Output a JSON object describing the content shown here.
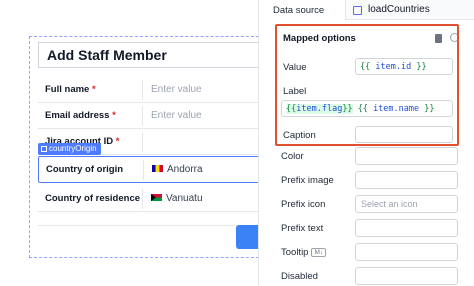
{
  "form": {
    "title": "Add Staff Member",
    "component_tag": "countryOrigin",
    "fields": [
      {
        "label": "Full name",
        "required": "*",
        "value": "Enter value",
        "is_placeholder": true
      },
      {
        "label": "Email address",
        "required": "*",
        "value": "Enter value",
        "is_placeholder": true
      },
      {
        "label": "Jira account ID",
        "required": "*",
        "value": "",
        "is_placeholder": true
      },
      {
        "label": "Country of origin",
        "required": "",
        "value": "Andorra",
        "is_placeholder": false
      },
      {
        "label": "Country of residence",
        "required": "",
        "value": "Vanuatu",
        "is_placeholder": false
      }
    ]
  },
  "panel": {
    "data_source_label": "Data source",
    "data_source_value": "loadCountries",
    "mapped_options": {
      "title": "Mapped options",
      "value_label": "Value",
      "value_code": {
        "open": "{{",
        "expr": "item.id",
        "close": "}}"
      },
      "label_label": "Label",
      "label_code": {
        "open1": "{{",
        "expr1": "item.flag",
        "close1": "}}",
        "open2": "{{",
        "expr2": "item.name",
        "close2": "}}"
      },
      "caption_label": "Caption",
      "caption_value": ""
    },
    "props": [
      {
        "label": "Color",
        "value": ""
      },
      {
        "label": "Prefix image",
        "value": ""
      },
      {
        "label": "Prefix icon",
        "value": "Select an icon"
      },
      {
        "label": "Prefix text",
        "value": ""
      },
      {
        "label": "Tooltip",
        "badge": "M↓",
        "value": ""
      },
      {
        "label": "Disabled",
        "value": ""
      }
    ]
  },
  "colors": {
    "accent": "#4f7cff",
    "highlight_border": "#e0502f",
    "required": "#dc2626"
  }
}
